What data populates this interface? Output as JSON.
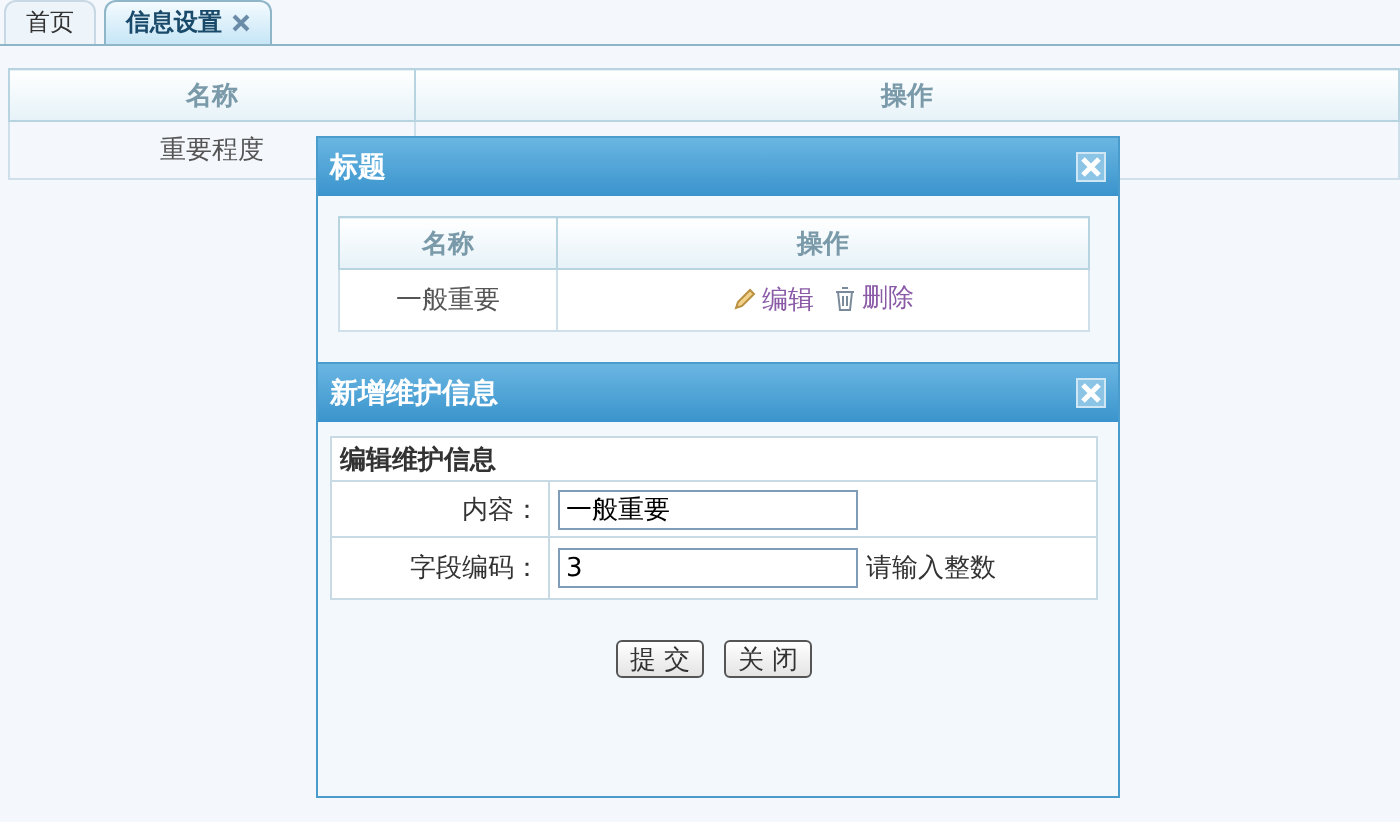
{
  "tabs": [
    {
      "label": "首页",
      "selected": false,
      "closable": false
    },
    {
      "label": "信息设置",
      "selected": true,
      "closable": true
    }
  ],
  "main_table": {
    "columns": [
      "名称",
      "操作"
    ],
    "rows": [
      {
        "name": "重要程度",
        "actions": []
      }
    ]
  },
  "list_dialog": {
    "title": "标题",
    "columns": [
      "名称",
      "操作"
    ],
    "rows": [
      {
        "name": "一般重要",
        "actions": [
          {
            "kind": "edit",
            "label": "编辑"
          },
          {
            "kind": "delete",
            "label": "删除"
          }
        ]
      }
    ]
  },
  "form_dialog": {
    "title": "新增维护信息",
    "section": "编辑维护信息",
    "fields": [
      {
        "label": "内容：",
        "value": "一般重要"
      },
      {
        "label": "字段编码：",
        "value": "3",
        "hint": "请输入整数"
      }
    ],
    "buttons": [
      "提 交",
      "关 闭"
    ]
  }
}
